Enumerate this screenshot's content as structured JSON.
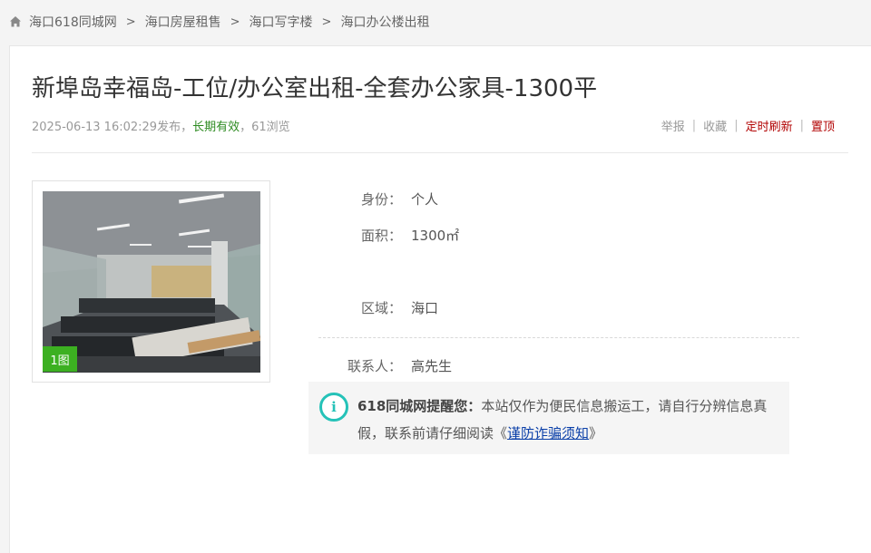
{
  "breadcrumb": {
    "items": [
      "海口618同城网",
      "海口房屋租售",
      "海口写字楼",
      "海口办公楼出租"
    ],
    "separator": ">"
  },
  "listing": {
    "title": "新埠岛幸福岛-工位/办公室出租-全套办公家具-1300平",
    "published": "2025-06-13 16:02:29发布，",
    "validity": "长期有效",
    "views": "，61浏览"
  },
  "actions": {
    "report": "举报",
    "favorite": "收藏",
    "timed_refresh": "定时刷新",
    "pin_top": "置顶"
  },
  "photo": {
    "count_badge": "1图"
  },
  "details": {
    "identity_label": "身份：",
    "identity_value": "个人",
    "area_label": "面积：",
    "area_value": "1300㎡",
    "region_label": "区域：",
    "region_value": "海口",
    "contact_label": "联系人：",
    "contact_value": "高先生"
  },
  "notice": {
    "brand": "618同城网提醒您：",
    "text_before": "本站仅作为便民信息搬运工，请自行分辨信息真假，联系前请仔细阅读《",
    "link": "谨防诈骗须知",
    "text_after": "》"
  },
  "colors": {
    "validity": "#2e8b22",
    "action_red": "#b10000",
    "badge": "#3cb021",
    "info_icon": "#25c2b8",
    "link": "#0a3fa8"
  }
}
